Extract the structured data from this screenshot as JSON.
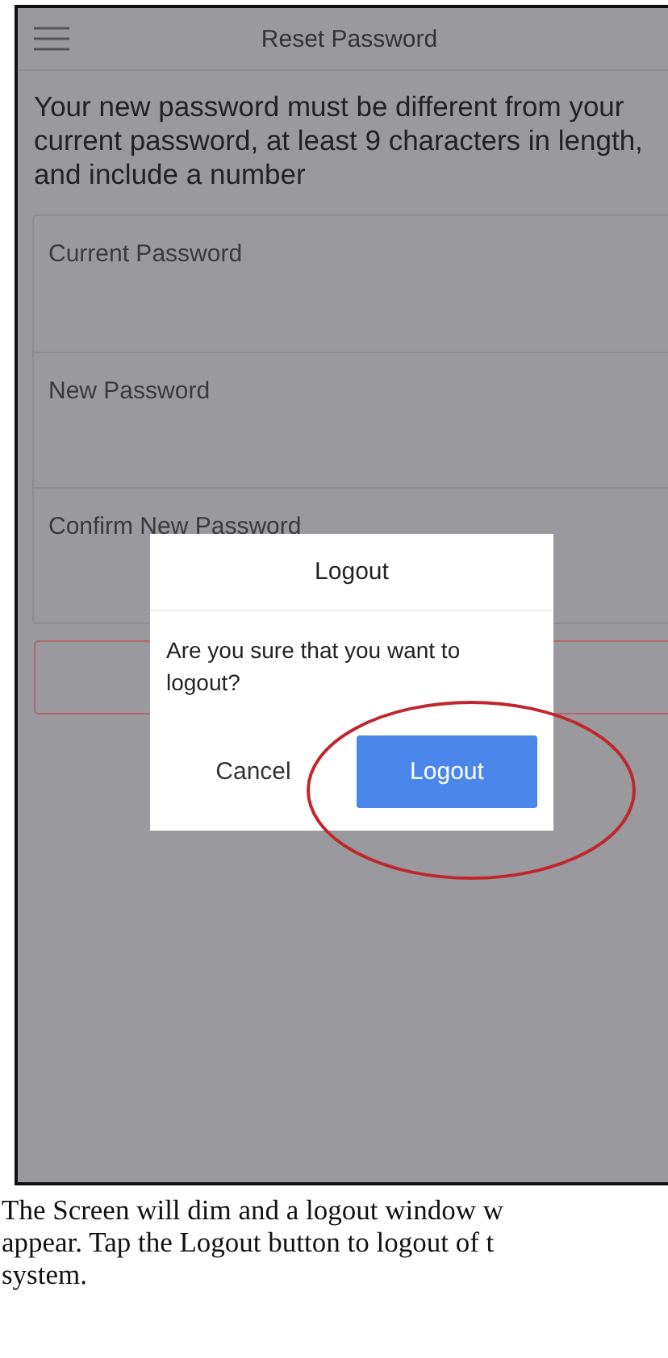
{
  "header": {
    "title": "Reset Password"
  },
  "instructions": "Your new password must be different from your current password, at least 9 characters in length, and include a number",
  "fields": [
    {
      "label": "Current Password"
    },
    {
      "label": "New Password"
    },
    {
      "label": "Confirm New Password"
    }
  ],
  "dialog": {
    "title": "Logout",
    "message": "Are you sure that you want to logout?",
    "buttons": [
      {
        "label": "Cancel",
        "kind": "plain"
      },
      {
        "label": "Logout",
        "kind": "primary"
      }
    ]
  },
  "caption": [
    "The Screen will dim and a logout window w",
    "appear. Tap the Logout button to logout of t",
    "system."
  ]
}
